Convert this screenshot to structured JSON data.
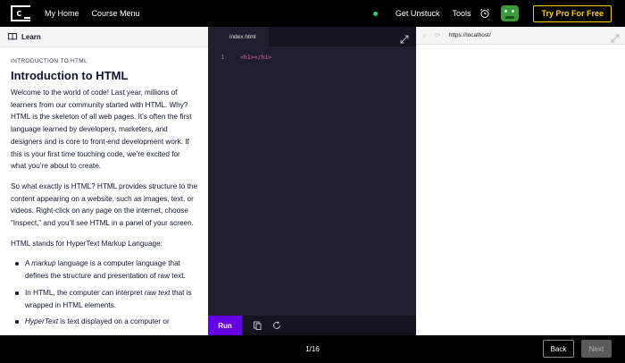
{
  "topbar": {
    "logo_letter": "c",
    "nav": [
      "My Home",
      "Course Menu"
    ],
    "get_unstuck": "Get Unstuck",
    "tools": "Tools",
    "pro_button": "Try Pro For Free",
    "status_color": "#2ecc71",
    "accent_color": "#ffd300"
  },
  "learn": {
    "header": "Learn",
    "eyebrow": "INTRODUCTION TO HTML",
    "title": "Introduction to HTML",
    "paragraphs": [
      "Welcome to the world of code! Last year, millions of learners from our community started with HTML. Why? HTML is the skeleton of all web pages. It’s often the first language learned by developers, marketers, and designers and is core to front-end development work. If this is your first time touching code, we’re excited for what you’re about to create.",
      "So what exactly is HTML? HTML provides structure to the content appearing on a website, such as images, text, or videos. Right-click on any page on the internet, choose “Inspect,” and you’ll see HTML in a panel of your screen.",
      "HTML stands for HyperText Markup Language:"
    ],
    "bullets": [
      {
        "pre": "A ",
        "em": "markup",
        "post": " language is a computer language that defines the structure and presentation of raw text."
      },
      {
        "pre": "In HTML, the computer can interpret ",
        "em": "raw text",
        "post": " that is wrapped in HTML elements."
      },
      {
        "pre": "",
        "em": "HyperText",
        "post": " is text displayed on a computer or"
      }
    ]
  },
  "editor": {
    "tab": "index.html",
    "line_numbers": [
      "1"
    ],
    "code_lines": [
      "<h1></h1>"
    ],
    "run_label": "Run",
    "run_color": "#6400e4"
  },
  "browser": {
    "back_icon": "arrow-left-icon",
    "refresh_icon": "refresh-icon",
    "url": "https://localhost/"
  },
  "footer": {
    "page": "1/16",
    "back": "Back",
    "next": "Next"
  }
}
